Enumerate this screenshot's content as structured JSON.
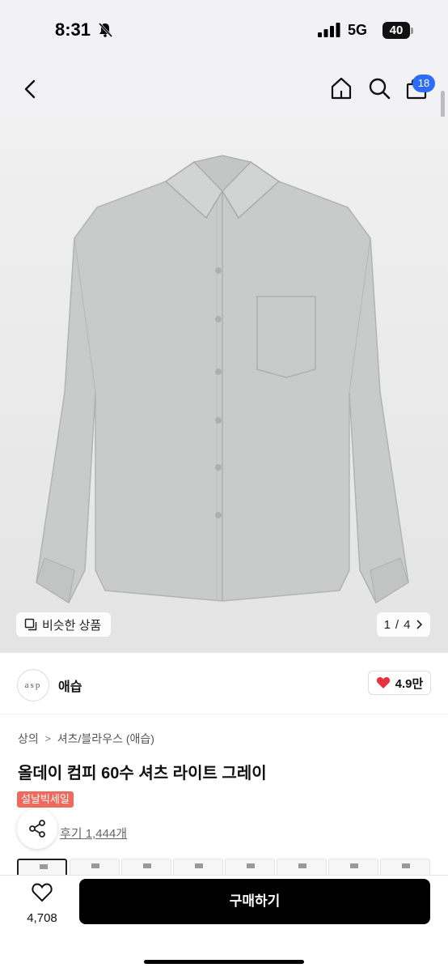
{
  "status": {
    "time": "8:31",
    "network": "5G",
    "battery": "40"
  },
  "nav": {
    "cart_badge": "18"
  },
  "gallery": {
    "similar_label": "비슷한 상품",
    "page_current": "1",
    "page_total": "4",
    "page_sep": "/"
  },
  "brand": {
    "logo_text": "asp",
    "name": "애습",
    "like_count": "4.9만"
  },
  "breadcrumb": {
    "items": [
      "상의",
      "셔츠/블라우스 (애습)"
    ],
    "separator": ">"
  },
  "product": {
    "title": "올데이 컴피 60수 셔츠 라이트 그레이",
    "sale_badge": "설날빅세일",
    "review_link": "후기 1,444개"
  },
  "bottom_bar": {
    "wish_count": "4,708",
    "buy_label": "구매하기"
  },
  "colors": {
    "accent_badge": "#2d6cf6",
    "sale_badge": "#ef6a5c",
    "heart": "#e6323e",
    "buy_button": "#000000"
  },
  "icons": {
    "back": "chevron-left-icon",
    "home": "home-icon",
    "search": "search-icon",
    "cart": "shopping-bag-icon",
    "like": "heart-filled-icon",
    "share": "share-icon",
    "wish": "heart-outline-icon"
  }
}
